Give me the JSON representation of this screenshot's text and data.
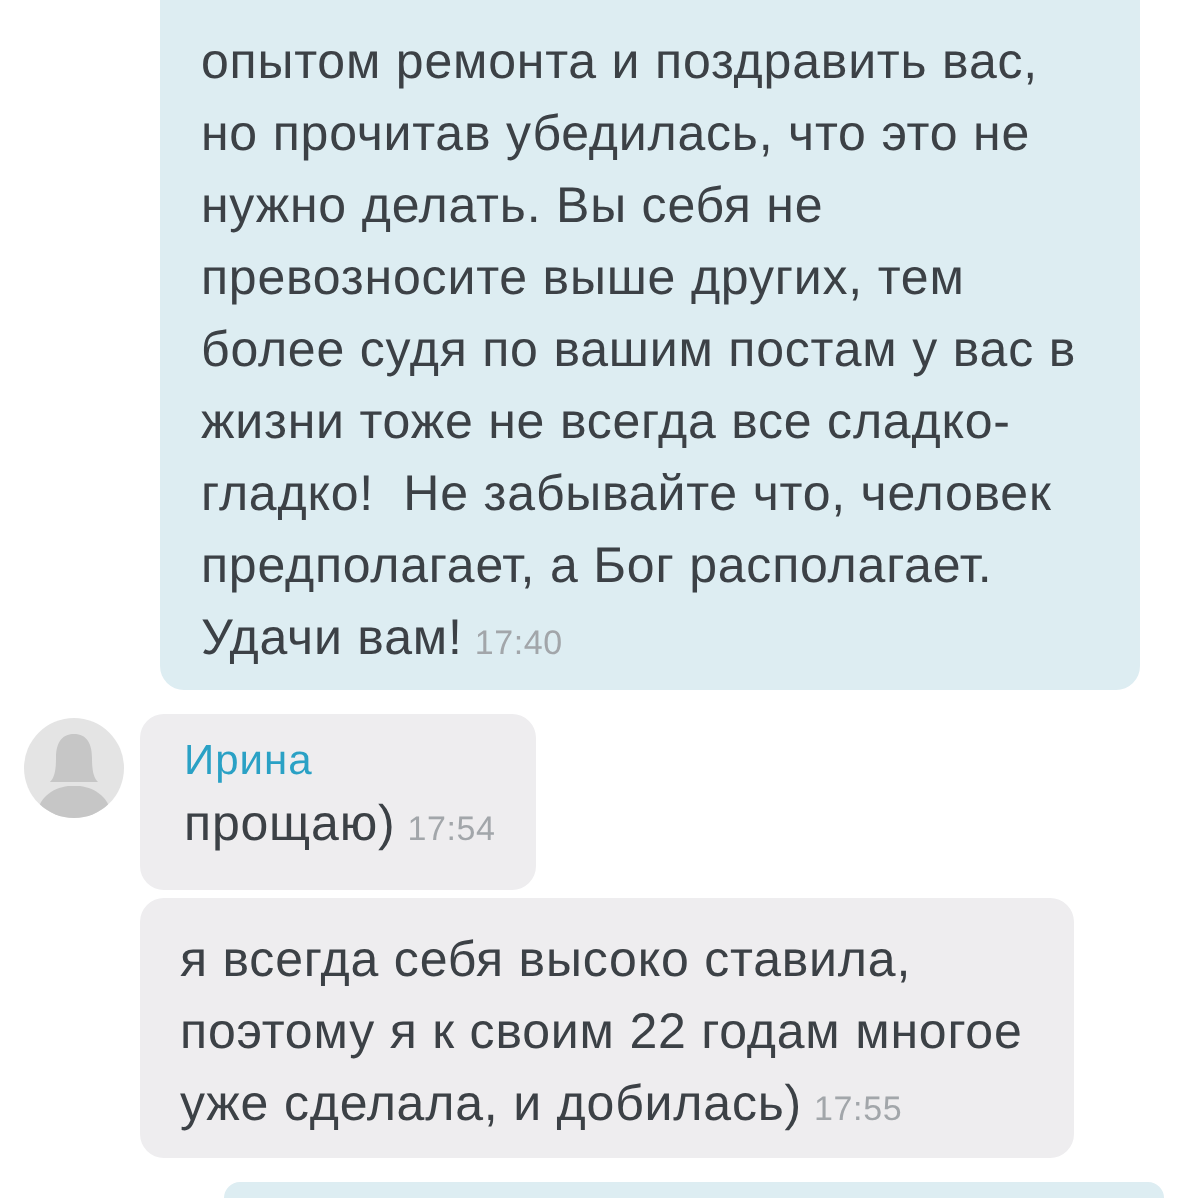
{
  "messages": [
    {
      "kind": "outgoing",
      "lines": [
        "опытом ремонта и поздравить вас,",
        "но прочитав убедилась, что это не",
        "нужно делать. Вы себя не",
        "превозносите выше других, тем",
        "более судя по вашим постам у вас в",
        "жизни тоже не всегда все сладко-",
        "гладко!  Не забывайте что, человек",
        "предполагает, а Бог располагает.",
        "Удачи вам!"
      ],
      "time": "17:40"
    },
    {
      "kind": "incoming",
      "sender": "Ирина",
      "lines": [
        "прощаю)"
      ],
      "time": "17:54"
    },
    {
      "kind": "incoming",
      "lines": [
        "я всегда себя высоко ставила,",
        "поэтому я к своим 22 годам многое",
        "уже сделала, и добилась)"
      ],
      "time": "17:55"
    },
    {
      "kind": "outgoing"
    }
  ]
}
